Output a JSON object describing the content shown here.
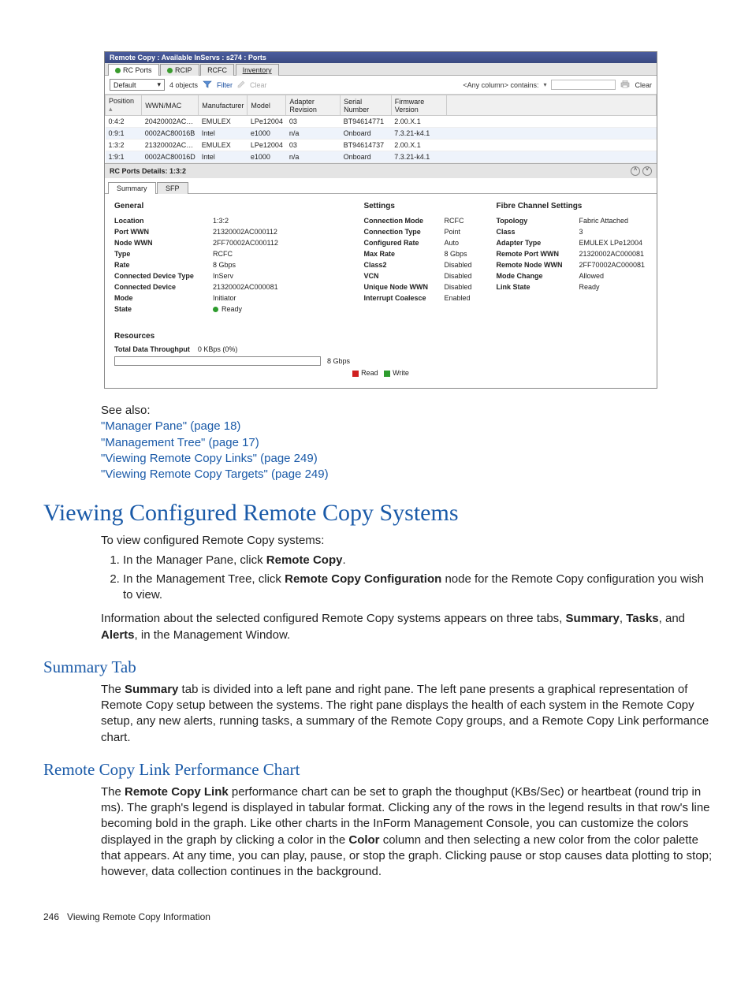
{
  "screenshot": {
    "title": "Remote Copy : Available InServs : s274 : Ports",
    "topTabs": [
      "RC Ports",
      "RCIP",
      "RCFC",
      "Inventory"
    ],
    "toolbar": {
      "selectValue": "Default",
      "count": "4 objects",
      "filter": "Filter",
      "clear": "Clear",
      "searchHint": "<Any column> contains:",
      "clearBtn": "Clear"
    },
    "columns": [
      "Position",
      "WWN/MAC",
      "Manufacturer",
      "Model",
      "Adapter Revision",
      "Serial Number",
      "Firmware Version"
    ],
    "rows": [
      {
        "pos": "0:4:2",
        "wwn": "20420002AC…",
        "man": "EMULEX",
        "model": "LPe12004",
        "rev": "03",
        "ser": "BT94614771",
        "fw": "2.00.X.1"
      },
      {
        "pos": "0:9:1",
        "wwn": "0002AC80016B",
        "man": "Intel",
        "model": "e1000",
        "rev": "n/a",
        "ser": "Onboard",
        "fw": "7.3.21-k4.1"
      },
      {
        "pos": "1:3:2",
        "wwn": "21320002AC…",
        "man": "EMULEX",
        "model": "LPe12004",
        "rev": "03",
        "ser": "BT94614737",
        "fw": "2.00.X.1"
      },
      {
        "pos": "1:9:1",
        "wwn": "0002AC80016D",
        "man": "Intel",
        "model": "e1000",
        "rev": "n/a",
        "ser": "Onboard",
        "fw": "7.3.21-k4.1"
      }
    ],
    "detailsHeader": "RC Ports Details: 1:3:2",
    "subTabs": [
      "Summary",
      "SFP"
    ],
    "general": {
      "title": "General",
      "rows": [
        [
          "Location",
          "1:3:2"
        ],
        [
          "Port WWN",
          "21320002AC000112"
        ],
        [
          "Node WWN",
          "2FF70002AC000112"
        ],
        [
          "Type",
          "RCFC"
        ],
        [
          "Rate",
          "8 Gbps"
        ],
        [
          "Connected Device Type",
          "InServ"
        ],
        [
          "Connected Device",
          "21320002AC000081"
        ],
        [
          "Mode",
          "Initiator"
        ],
        [
          "State",
          "Ready"
        ]
      ]
    },
    "settings": {
      "title": "Settings",
      "rows": [
        [
          "Connection Mode",
          "RCFC"
        ],
        [
          "Connection Type",
          "Point"
        ],
        [
          "Configured Rate",
          "Auto"
        ],
        [
          "Max Rate",
          "8 Gbps"
        ],
        [
          "Class2",
          "Disabled"
        ],
        [
          "VCN",
          "Disabled"
        ],
        [
          "Unique Node WWN",
          "Disabled"
        ],
        [
          "Interrupt Coalesce",
          "Enabled"
        ]
      ]
    },
    "fcs": {
      "title": "Fibre Channel Settings",
      "rows": [
        [
          "Topology",
          "Fabric Attached"
        ],
        [
          "Class",
          "3"
        ],
        [
          "Adapter Type",
          "EMULEX LPe12004"
        ],
        [
          "Remote Port WWN",
          "21320002AC000081"
        ],
        [
          "Remote Node WWN",
          "2FF70002AC000081"
        ],
        [
          "Mode Change",
          "Allowed"
        ],
        [
          "Link State",
          "Ready"
        ]
      ]
    },
    "resources": {
      "title": "Resources",
      "throughputLabel": "Total Data Throughput",
      "throughputValue": "0 KBps (0%)",
      "barMax": "8 Gbps",
      "legendRead": "Read",
      "legendWrite": "Write"
    }
  },
  "doc": {
    "seeAlso": "See also:",
    "links": [
      "\"Manager Pane\" (page 18)",
      "\"Management Tree\" (page 17)",
      "\"Viewing Remote Copy Links\" (page 249)",
      "\"Viewing Remote Copy Targets\" (page 249)"
    ],
    "h1": "Viewing Configured Remote Copy Systems",
    "intro": "To view configured Remote Copy systems:",
    "step1a": "In the Manager Pane, click ",
    "step1b": "Remote Copy",
    "step1c": ".",
    "step2a": "In the Management Tree, click ",
    "step2b": "Remote Copy Configuration",
    "step2c": " node for the Remote Copy configuration you wish to view.",
    "para1a": "Information about the selected configured Remote Copy systems appears on three tabs, ",
    "para1b": "Summary",
    "para1c": ", ",
    "para1d": "Tasks",
    "para1e": ", and ",
    "para1f": "Alerts",
    "para1g": ", in the Management Window.",
    "h2a": "Summary Tab",
    "para2a": "The ",
    "para2b": "Summary",
    "para2c": " tab is divided into a left pane and right pane. The left pane presents a graphical representation of Remote Copy setup between the systems. The right pane displays the health of each system in the Remote Copy setup, any new alerts, running tasks, a summary of the Remote Copy groups, and a Remote Copy Link performance chart.",
    "h2b": "Remote Copy Link Performance Chart",
    "para3a": "The ",
    "para3b": "Remote Copy Link",
    "para3c": " performance chart can be set to graph the thoughput (KBs/Sec) or heartbeat (round trip in ms). The graph's legend is displayed in tabular format. Clicking any of the rows in the legend results in that row's line becoming bold in the graph. Like other charts in the InForm Management Console, you can customize the colors displayed in the graph by clicking a color in the ",
    "para3d": "Color",
    "para3e": " column and then selecting a new color from the color palette that appears. At any time, you can play, pause, or stop the graph. Clicking pause or stop causes data plotting to stop; however, data collection continues in the background.",
    "footerPage": "246",
    "footerText": "Viewing Remote Copy Information"
  }
}
